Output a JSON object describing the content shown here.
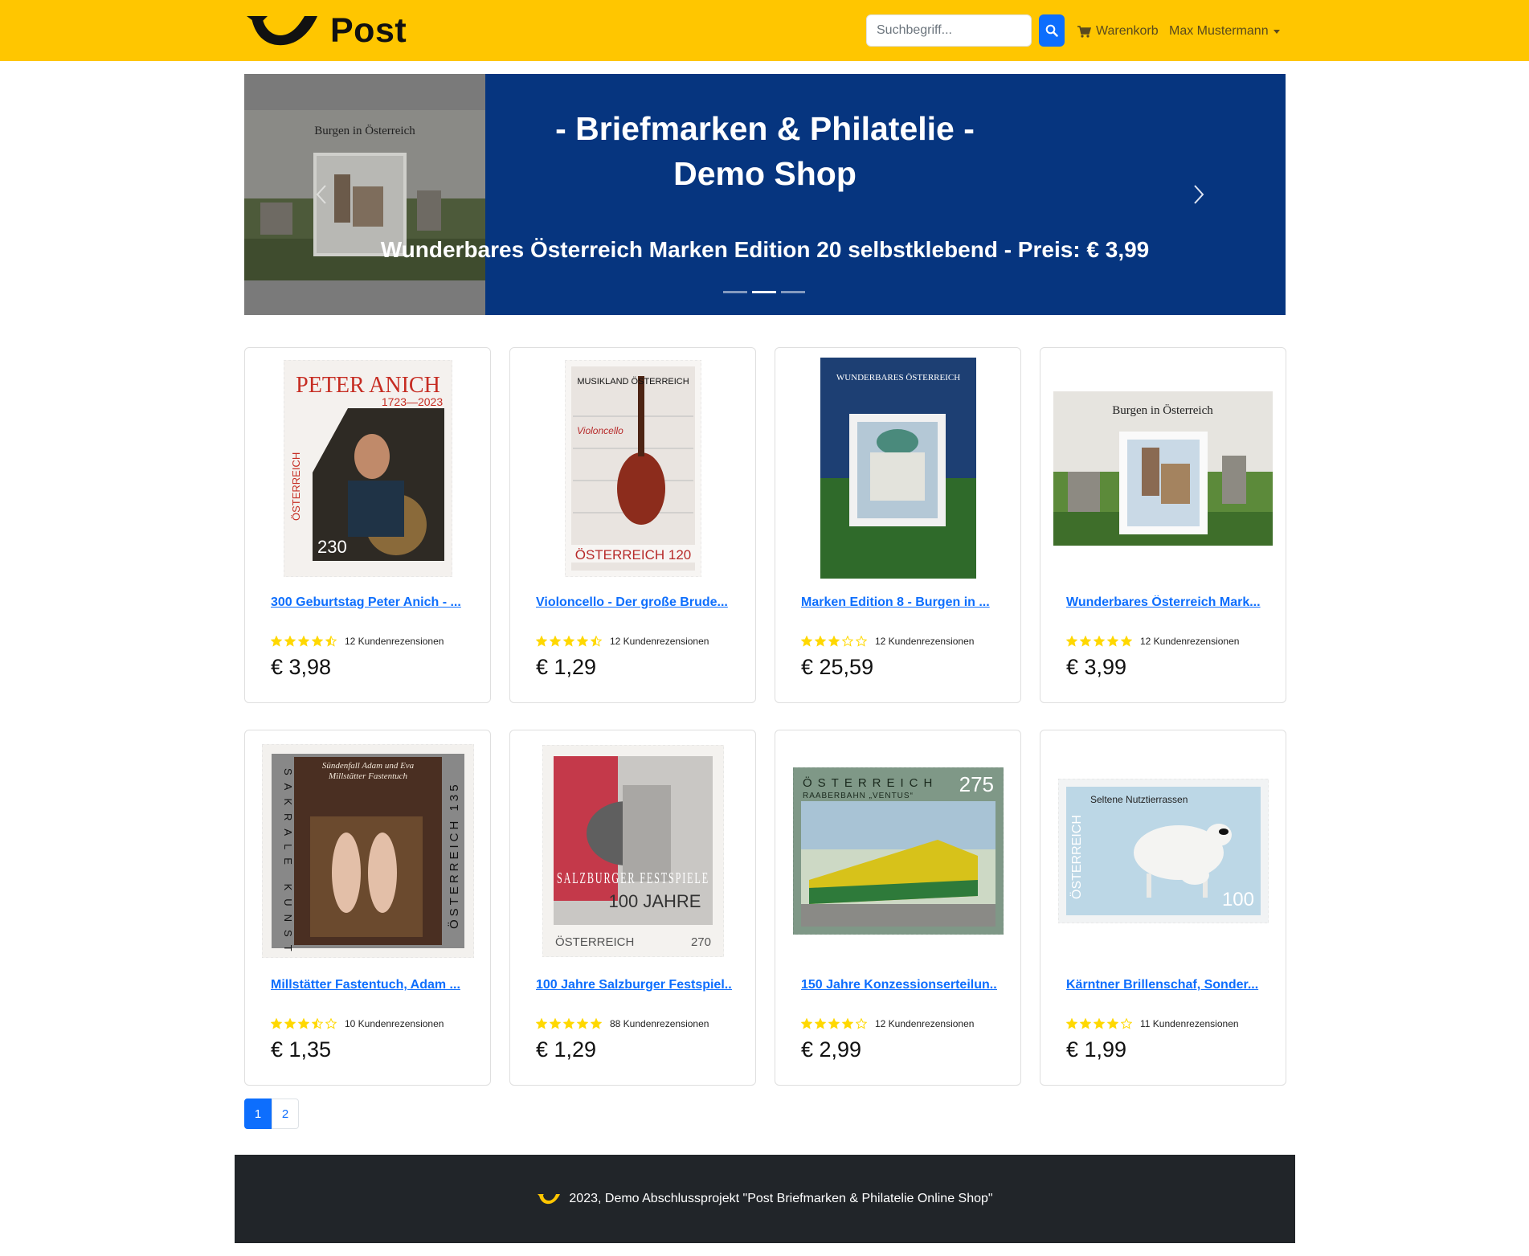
{
  "header": {
    "brand": "Post",
    "search_placeholder": "Suchbegriff...",
    "cart_label": "Warenkorb",
    "user_label": "Max Mustermann"
  },
  "carousel": {
    "title_line1": "- Briefmarken & Philatelie -",
    "title_line2": "Demo Shop",
    "caption": "Wunderbares Österreich Marken Edition 20 selbstklebend - Preis: € 3,99",
    "image_label": "Burgen in Österreich",
    "active_index": 1,
    "slide_count": 3
  },
  "products": [
    {
      "title": "300 Geburtstag Peter Anich - ...",
      "rating": 4.5,
      "reviews": "12 Kundenrezensionen",
      "price": "€ 3,98",
      "stamp_text": "PETER ANICH",
      "stamp_sub": "1723—2023",
      "stamp_value": "230",
      "stamp_side": "ÖSTERREICH"
    },
    {
      "title": "Violoncello - Der große Brude...",
      "rating": 4.5,
      "reviews": "12 Kundenrezensionen",
      "price": "€ 1,29",
      "stamp_text": "MUSIKLAND ÖSTERREICH",
      "stamp_sub": "Violoncello",
      "stamp_value": "ÖSTERREICH 120"
    },
    {
      "title": "Marken Edition 8 - Burgen in ...",
      "rating": 3,
      "reviews": "12 Kundenrezensionen",
      "price": "€ 25,59",
      "stamp_text": "WUNDERBARES ÖSTERREICH"
    },
    {
      "title": "Wunderbares Österreich Mark...",
      "rating": 5,
      "reviews": "12 Kundenrezensionen",
      "price": "€ 3,99",
      "stamp_text": "Burgen in Österreich"
    },
    {
      "title": "Millstätter Fastentuch, Adam ...",
      "rating": 3.5,
      "reviews": "10 Kundenrezensionen",
      "price": "€ 1,35",
      "stamp_text": "Sündenfall Adam und Eva",
      "stamp_sub": "Millstätter Fastentuch",
      "stamp_side": "SAKRALE KUNST",
      "stamp_value": "ÖSTERREICH 135"
    },
    {
      "title": "100 Jahre Salzburger Festspiel...",
      "rating": 5,
      "reviews": "88 Kundenrezensionen",
      "price": "€ 1,29",
      "stamp_text": "SALZBURGER FESTSPIELE",
      "stamp_sub": "100 JAHRE",
      "stamp_value": "270",
      "stamp_side": "ÖSTERREICH"
    },
    {
      "title": "150 Jahre Konzessionserteilun...",
      "rating": 4,
      "reviews": "12 Kundenrezensionen",
      "price": "€ 2,99",
      "stamp_text": "ÖSTERREICH",
      "stamp_sub": "RAABERBAHN „VENTUS“",
      "stamp_value": "275"
    },
    {
      "title": "Kärntner Brillenschaf, Sonder...",
      "rating": 4,
      "reviews": "11 Kundenrezensionen",
      "price": "€ 1,99",
      "stamp_text": "Seltene Nutztierrassen",
      "stamp_side": "ÖSTERREICH",
      "stamp_value": "100"
    }
  ],
  "pagination": {
    "pages": [
      "1",
      "2"
    ],
    "active": "1"
  },
  "footer": {
    "text": "2023, Demo Abschlussprojekt \"Post Briefmarken & Philatelie Online Shop\""
  },
  "colors": {
    "header": "#ffc600",
    "carousel_bg": "#06357f",
    "link": "#0d6efd",
    "star": "#ffd800",
    "footer": "#212529"
  }
}
